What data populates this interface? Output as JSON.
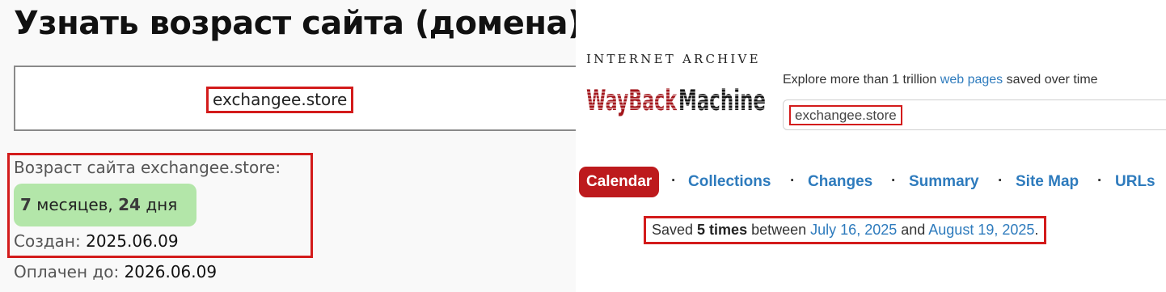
{
  "left": {
    "title": "Узнать возраст сайта (домена)",
    "domain_value": "exchangee.store",
    "age_label": "Возраст сайта exchangee.store:",
    "age": {
      "months_num": "7",
      "months_word": "месяцев,",
      "days_num": "24",
      "days_word": "дня"
    },
    "created_label": "Создан:",
    "created_value": "2025.06.09",
    "paid_label": "Оплачен до:",
    "paid_value": "2026.06.09"
  },
  "wayback": {
    "brand_top": "INTERNET ARCHIVE",
    "brand_main": "WaybackMachine",
    "explore_prefix": "Explore more than 1 trillion ",
    "explore_link": "web pages",
    "explore_suffix": " saved over time",
    "search_value": "exchangee.store",
    "tabs": [
      "Calendar",
      "Collections",
      "Changes",
      "Summary",
      "Site Map",
      "URLs"
    ],
    "active_tab": "Calendar",
    "saved_prefix": "Saved ",
    "saved_count": "5 times",
    "saved_between": " between ",
    "saved_from": "July 16, 2025",
    "saved_and": " and ",
    "saved_to": "August 19, 2025",
    "saved_end": ".",
    "colors": {
      "accent_red": "#bd1a1d",
      "link_blue": "#2e7bbd",
      "highlight_red": "#d31b1b",
      "badge_green": "#b3e6a9"
    }
  }
}
